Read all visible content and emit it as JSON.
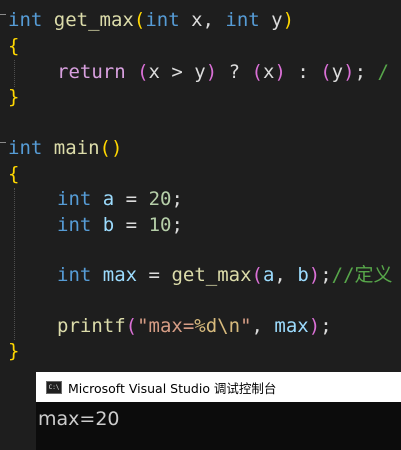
{
  "editor": {
    "l1": {
      "t1": "int",
      "t2": " ",
      "t3": "get_max",
      "t4": "(",
      "t5": "int",
      "t6": " x, ",
      "t7": "int",
      "t8": " y",
      "t9": ")"
    },
    "l2": {
      "t1": "{"
    },
    "l3": {
      "t1": "return",
      "t2": " ",
      "t3": "(",
      "t4": "x > y",
      "t5": ")",
      "t6": " ? ",
      "t7": "(",
      "t8": "x",
      "t9": ")",
      "t10": " : ",
      "t11": "(",
      "t12": "y",
      "t13": ")",
      "t14": "; ",
      "t15": "/"
    },
    "l4": {
      "t1": "}"
    },
    "l5": {
      "t1": "int",
      "t2": " ",
      "t3": "main",
      "t4": "()"
    },
    "l6": {
      "t1": "{"
    },
    "l7": {
      "t1": "int",
      "t2": " ",
      "t3": "a",
      "t4": " = ",
      "t5": "20",
      "t6": ";"
    },
    "l8": {
      "t1": "int",
      "t2": " ",
      "t3": "b",
      "t4": " = ",
      "t5": "10",
      "t6": ";"
    },
    "l9": {
      "t1": "int",
      "t2": " ",
      "t3": "max",
      "t4": " = ",
      "t5": "get_max",
      "t6": "(",
      "t7": "a",
      "t8": ", ",
      "t9": "b",
      "t10": ")",
      "t11": ";",
      "t12": "//定义"
    },
    "l10": {
      "t1": "printf",
      "t2": "(",
      "t3": "\"max=",
      "t4": "%d\\n",
      "t5": "\"",
      "t6": ", ",
      "t7": "max",
      "t8": ")",
      "t9": ";"
    },
    "l11": {
      "t1": "}"
    }
  },
  "console": {
    "icon_label": "C:\\",
    "title": "Microsoft Visual Studio 调试控制台",
    "output": "max=20"
  },
  "colors": {
    "background": "#1e1e1e",
    "keyword": "#569cd6",
    "function": "#dcdcaa",
    "variable": "#9cdcfe",
    "number": "#b5cea8",
    "string": "#d69d85",
    "comment": "#57a64a"
  },
  "icons": {
    "console": "console-app-icon",
    "fold": "fold-marker-icon"
  }
}
